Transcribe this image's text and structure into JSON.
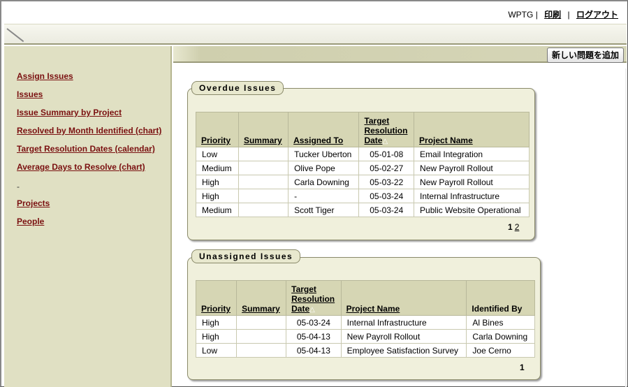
{
  "header": {
    "user": "WPTG",
    "divider": "|",
    "print_label": "印刷",
    "logout_label": "ログアウト"
  },
  "actions": {
    "add_issue_label": "新しい問題を追加"
  },
  "sidebar": {
    "items": [
      {
        "label": "Assign Issues"
      },
      {
        "label": "Issues"
      },
      {
        "label": "Issue Summary by Project"
      },
      {
        "label": "Resolved by Month Identified (chart)"
      },
      {
        "label": "Target Resolution Dates (calendar)"
      },
      {
        "label": "Average Days to Resolve (chart)"
      }
    ],
    "separator": "-",
    "lower_items": [
      {
        "label": "Projects"
      },
      {
        "label": "People"
      }
    ]
  },
  "overdue": {
    "title": "Overdue Issues",
    "columns": {
      "priority": "Priority",
      "summary": "Summary",
      "assigned_to": "Assigned To",
      "target_line1": "Target",
      "target_line2": "Resolution",
      "target_line3": "Date",
      "project": "Project Name"
    },
    "sort_indicator": "△",
    "rows": [
      {
        "priority": "Low",
        "summary": "",
        "assigned_to": "Tucker Uberton",
        "target": "05-01-08",
        "project": "Email Integration"
      },
      {
        "priority": "Medium",
        "summary": "",
        "assigned_to": "Olive Pope",
        "target": "05-02-27",
        "project": "New Payroll Rollout"
      },
      {
        "priority": "High",
        "summary": "",
        "assigned_to": "Carla Downing",
        "target": "05-03-22",
        "project": "New Payroll Rollout"
      },
      {
        "priority": "High",
        "summary": "",
        "assigned_to": "-",
        "target": "05-03-24",
        "project": "Internal Infrastructure"
      },
      {
        "priority": "Medium",
        "summary": "",
        "assigned_to": "Scott Tiger",
        "target": "05-03-24",
        "project": "Public Website Operational"
      }
    ],
    "pagination": {
      "current": "1",
      "next": "2"
    }
  },
  "unassigned": {
    "title": "Unassigned Issues",
    "columns": {
      "priority": "Priority",
      "summary": "Summary",
      "target_line1": "Target",
      "target_line2": "Resolution",
      "target_line3": "Date",
      "project": "Project Name",
      "identified_by": "Identified By"
    },
    "sort_indicator": "△",
    "rows": [
      {
        "priority": "High",
        "summary": "",
        "target": "05-03-24",
        "project": "Internal Infrastructure",
        "identified_by": "Al Bines"
      },
      {
        "priority": "High",
        "summary": "",
        "target": "05-04-13",
        "project": "New Payroll Rollout",
        "identified_by": "Carla Downing"
      },
      {
        "priority": "Low",
        "summary": "",
        "target": "05-04-13",
        "project": "Employee Satisfaction Survey",
        "identified_by": "Joe Cerno"
      }
    ],
    "pagination": {
      "current": "1"
    }
  }
}
